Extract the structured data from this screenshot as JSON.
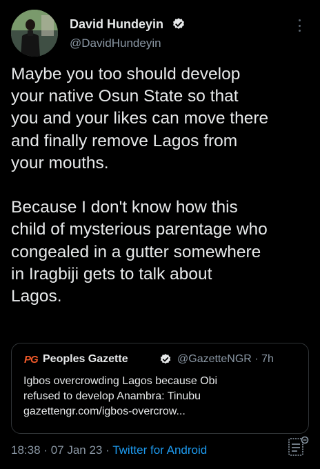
{
  "author": {
    "name": "David Hundeyin",
    "handle": "@DavidHundeyin",
    "verified_icon": "verified-badge-icon"
  },
  "tweet": {
    "paragraphs": [
      [
        "Maybe you too should develop",
        "your native Osun State so that",
        "you and your likes can move there",
        "and finally remove Lagos from",
        "your mouths."
      ],
      [
        "Because I don't know how this",
        "child of mysterious parentage who",
        "congealed in a gutter somewhere",
        "in Iragbiji gets to talk about",
        "Lagos."
      ]
    ]
  },
  "quoted_tweet": {
    "logo_text": "PG",
    "name": "Peoples Gazette",
    "handle_time": "@GazetteNGR · 7h",
    "lines": [
      "Igbos overcrowding Lagos because Obi",
      "refused to develop Anambra: Tinubu",
      "gazettengr.com/igbos-overcrow..."
    ]
  },
  "meta": {
    "time": "18:38",
    "date": "07 Jan 23",
    "separator": "·",
    "source": "Twitter for Android"
  },
  "colors": {
    "background": "#000000",
    "text": "#e7e9ea",
    "secondary": "#8b98a5",
    "link": "#1d9bf0",
    "border": "#2f3336",
    "logo": "#f05a2a"
  }
}
